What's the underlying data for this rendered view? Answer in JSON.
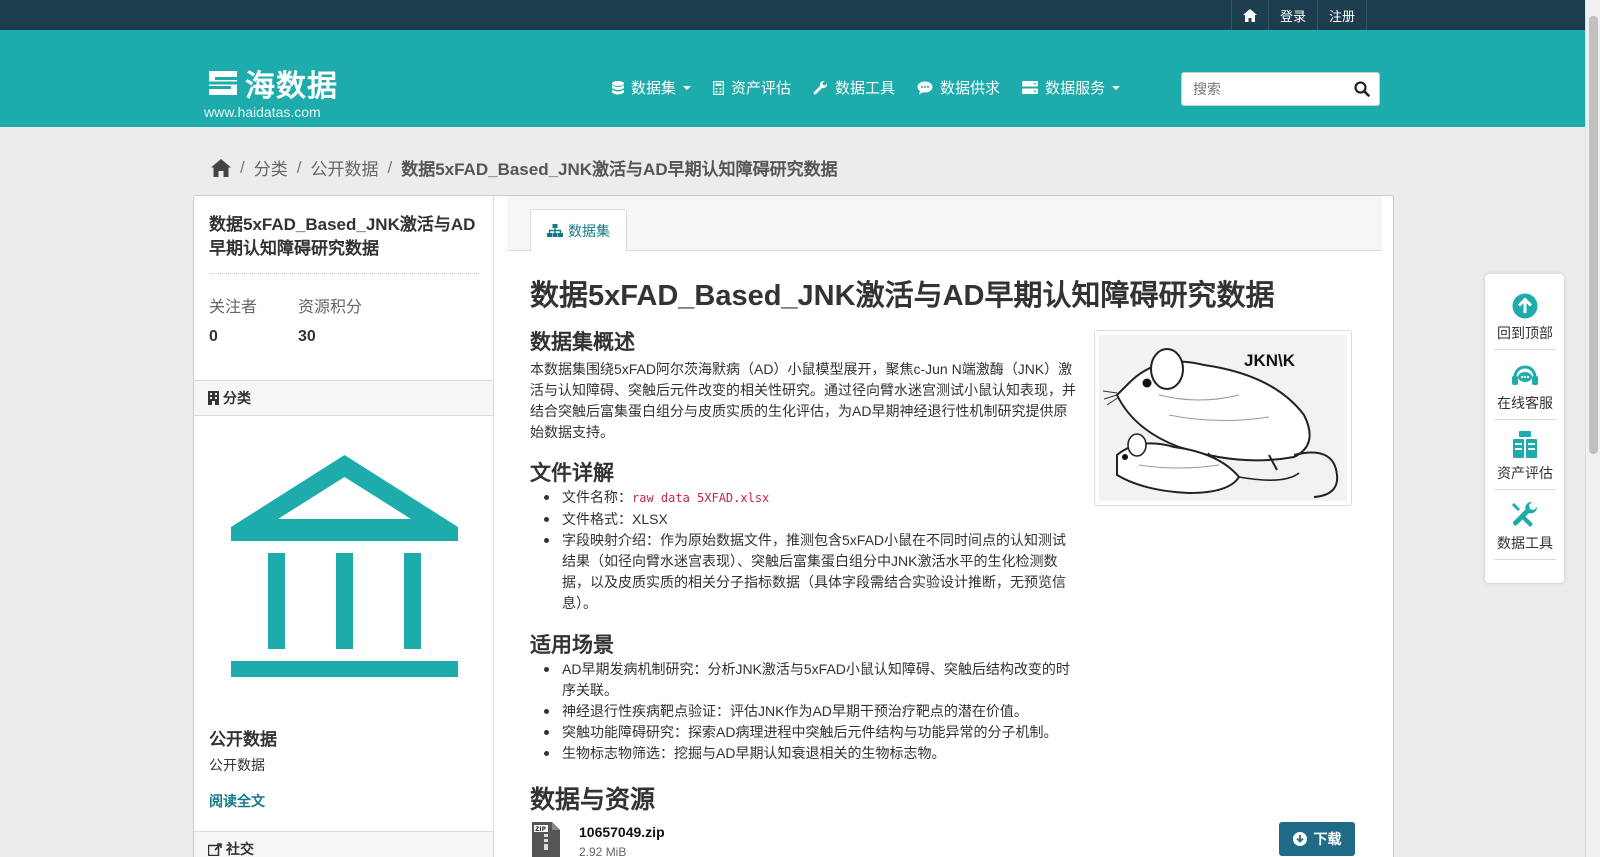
{
  "account_bar": {
    "login": "登录",
    "register": "注册",
    "home_icon": "home-icon"
  },
  "brand": {
    "name": "海数据",
    "url": "www.haidatas.com"
  },
  "nav": {
    "datasets": "数据集",
    "asset_eval": "资产评估",
    "data_tools": "数据工具",
    "data_demand": "数据供求",
    "data_services": "数据服务"
  },
  "search": {
    "placeholder": "搜索"
  },
  "breadcrumb": {
    "category": "分类",
    "public": "公开数据",
    "current": "数据5xFAD_Based_JNK激活与AD早期认知障碍研究数据"
  },
  "sidebar": {
    "title": "数据5xFAD_Based_JNK激活与AD早期认知障碍研究数据",
    "followers_label": "关注者",
    "followers": "0",
    "points_label": "资源积分",
    "points": "30",
    "category_header": "分类",
    "org_title": "公开数据",
    "org_desc": "公开数据",
    "read_more": "阅读全文",
    "social_header": "社交"
  },
  "content": {
    "tab": "数据集",
    "title": "数据5xFAD_Based_JNK激活与AD早期认知障碍研究数据",
    "overview_heading": "数据集概述",
    "overview_text": "本数据集围绕5xFAD阿尔茨海默病（AD）小鼠模型展开，聚焦c-Jun N端激酶（JNK）激活与认知障碍、突触后元件改变的相关性研究。通过径向臂水迷宫测试小鼠认知表现，并结合突触后富集蛋白组分与皮质实质的生化评估，为AD早期神经退行性机制研究提供原始数据支持。",
    "file_heading": "文件详解",
    "file_name_label": "文件名称：",
    "file_name": "raw data 5XFAD.xlsx",
    "file_format": "文件格式：XLSX",
    "field_desc": "字段映射介绍：作为原始数据文件，推测包含5xFAD小鼠在不同时间点的认知测试结果（如径向臂水迷宫表现）、突触后富集蛋白组分中JNK激活水平的生化检测数据，以及皮质实质的相关分子指标数据（具体字段需结合实验设计推断，无预览信息）。",
    "usage_heading": "适用场景",
    "usage": [
      "AD早期发病机制研究：分析JNK激活与5xFAD小鼠认知障碍、突触后结构改变的时序关联。",
      "神经退行性疾病靶点验证：评估JNK作为AD早期干预治疗靶点的潜在价值。",
      "突触功能障碍研究：探索AD病理进程中突触后元件结构与功能异常的分子机制。",
      "生物标志物筛选：挖掘与AD早期认知衰退相关的生物标志物。"
    ],
    "thumb_label": "JKN\\K",
    "resources_heading": "数据与资源",
    "resource_name": "10657049.zip",
    "resource_size": "2.92 MiB",
    "download": "下载"
  },
  "float_bar": {
    "top": "回到顶部",
    "service": "在线客服",
    "asset": "资产评估",
    "tools": "数据工具"
  },
  "colors": {
    "teal": "#1eabab",
    "dark": "#1c3d4d",
    "link": "#167a86",
    "button": "#1f6b87"
  }
}
